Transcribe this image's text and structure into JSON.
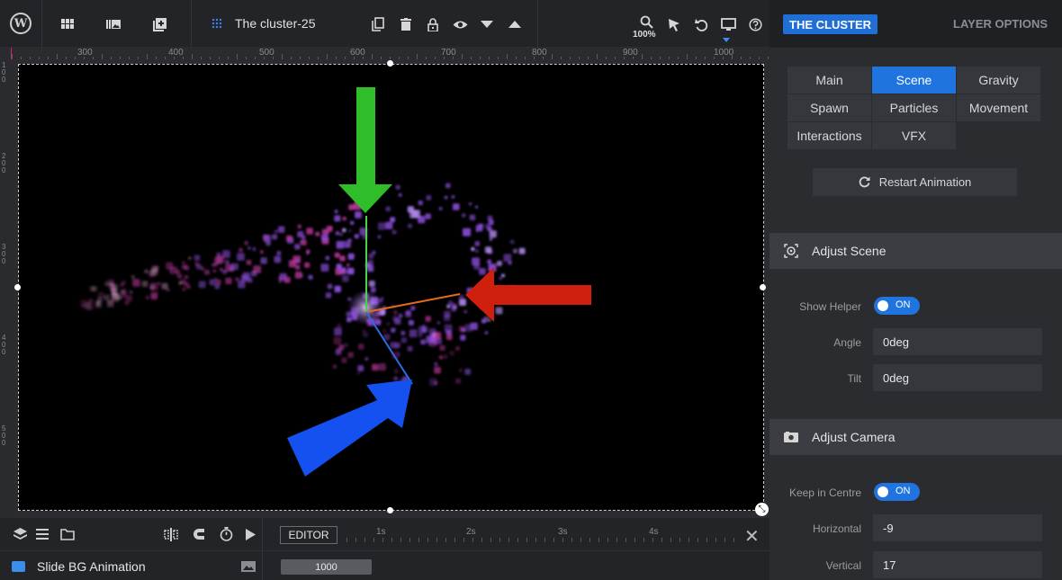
{
  "toolbar": {
    "wp_logo": "W",
    "slide_title": "The cluster-25",
    "zoom": "100%",
    "icons": [
      "wordpress-logo",
      "grid-icon",
      "library-icon",
      "add-slide-icon",
      "copy-icon",
      "trash-icon",
      "lock-icon",
      "eye-icon",
      "arrow-down-icon",
      "arrow-up-icon",
      "search-icon",
      "pointer-icon",
      "undo-icon",
      "desktop-icon",
      "help-icon"
    ]
  },
  "ruler": {
    "top": [
      "300",
      "400",
      "500",
      "600",
      "700",
      "800",
      "900",
      "1000"
    ],
    "left": [
      "100",
      "200",
      "300",
      "400",
      "500"
    ]
  },
  "timeline": {
    "editor_label": "EDITOR",
    "marks": [
      "1s",
      "2s",
      "3s",
      "4s"
    ],
    "layer_name": "Slide BG Animation",
    "duration": "1000"
  },
  "panel": {
    "badge": "THE CLUSTER",
    "layer_options": "LAYER OPTIONS",
    "tabs": [
      {
        "label": "Main"
      },
      {
        "label": "Scene"
      },
      {
        "label": "Gravity"
      },
      {
        "label": "Spawn"
      },
      {
        "label": "Particles"
      },
      {
        "label": "Movement"
      },
      {
        "label": "Interactions"
      },
      {
        "label": "VFX"
      }
    ],
    "active_tab": "Scene",
    "restart_label": "Restart Animation",
    "scene": {
      "title": "Adjust Scene",
      "show_helper_label": "Show Helper",
      "show_helper_value": "ON",
      "angle_label": "Angle",
      "angle_value": "0deg",
      "tilt_label": "Tilt",
      "tilt_value": "0deg"
    },
    "camera": {
      "title": "Adjust Camera",
      "keep_centre_label": "Keep in Centre",
      "keep_centre_value": "ON",
      "horizontal_label": "Horizontal",
      "horizontal_value": "-9",
      "vertical_label": "Vertical",
      "vertical_value": "17"
    }
  },
  "colors": {
    "accent": "#1f74e0",
    "arrow_green": "#2fbe2a",
    "arrow_red": "#d01f0c",
    "arrow_blue": "#1550f0",
    "particle_purple": "#8a4ddb",
    "particle_pink": "#c13aa0"
  }
}
